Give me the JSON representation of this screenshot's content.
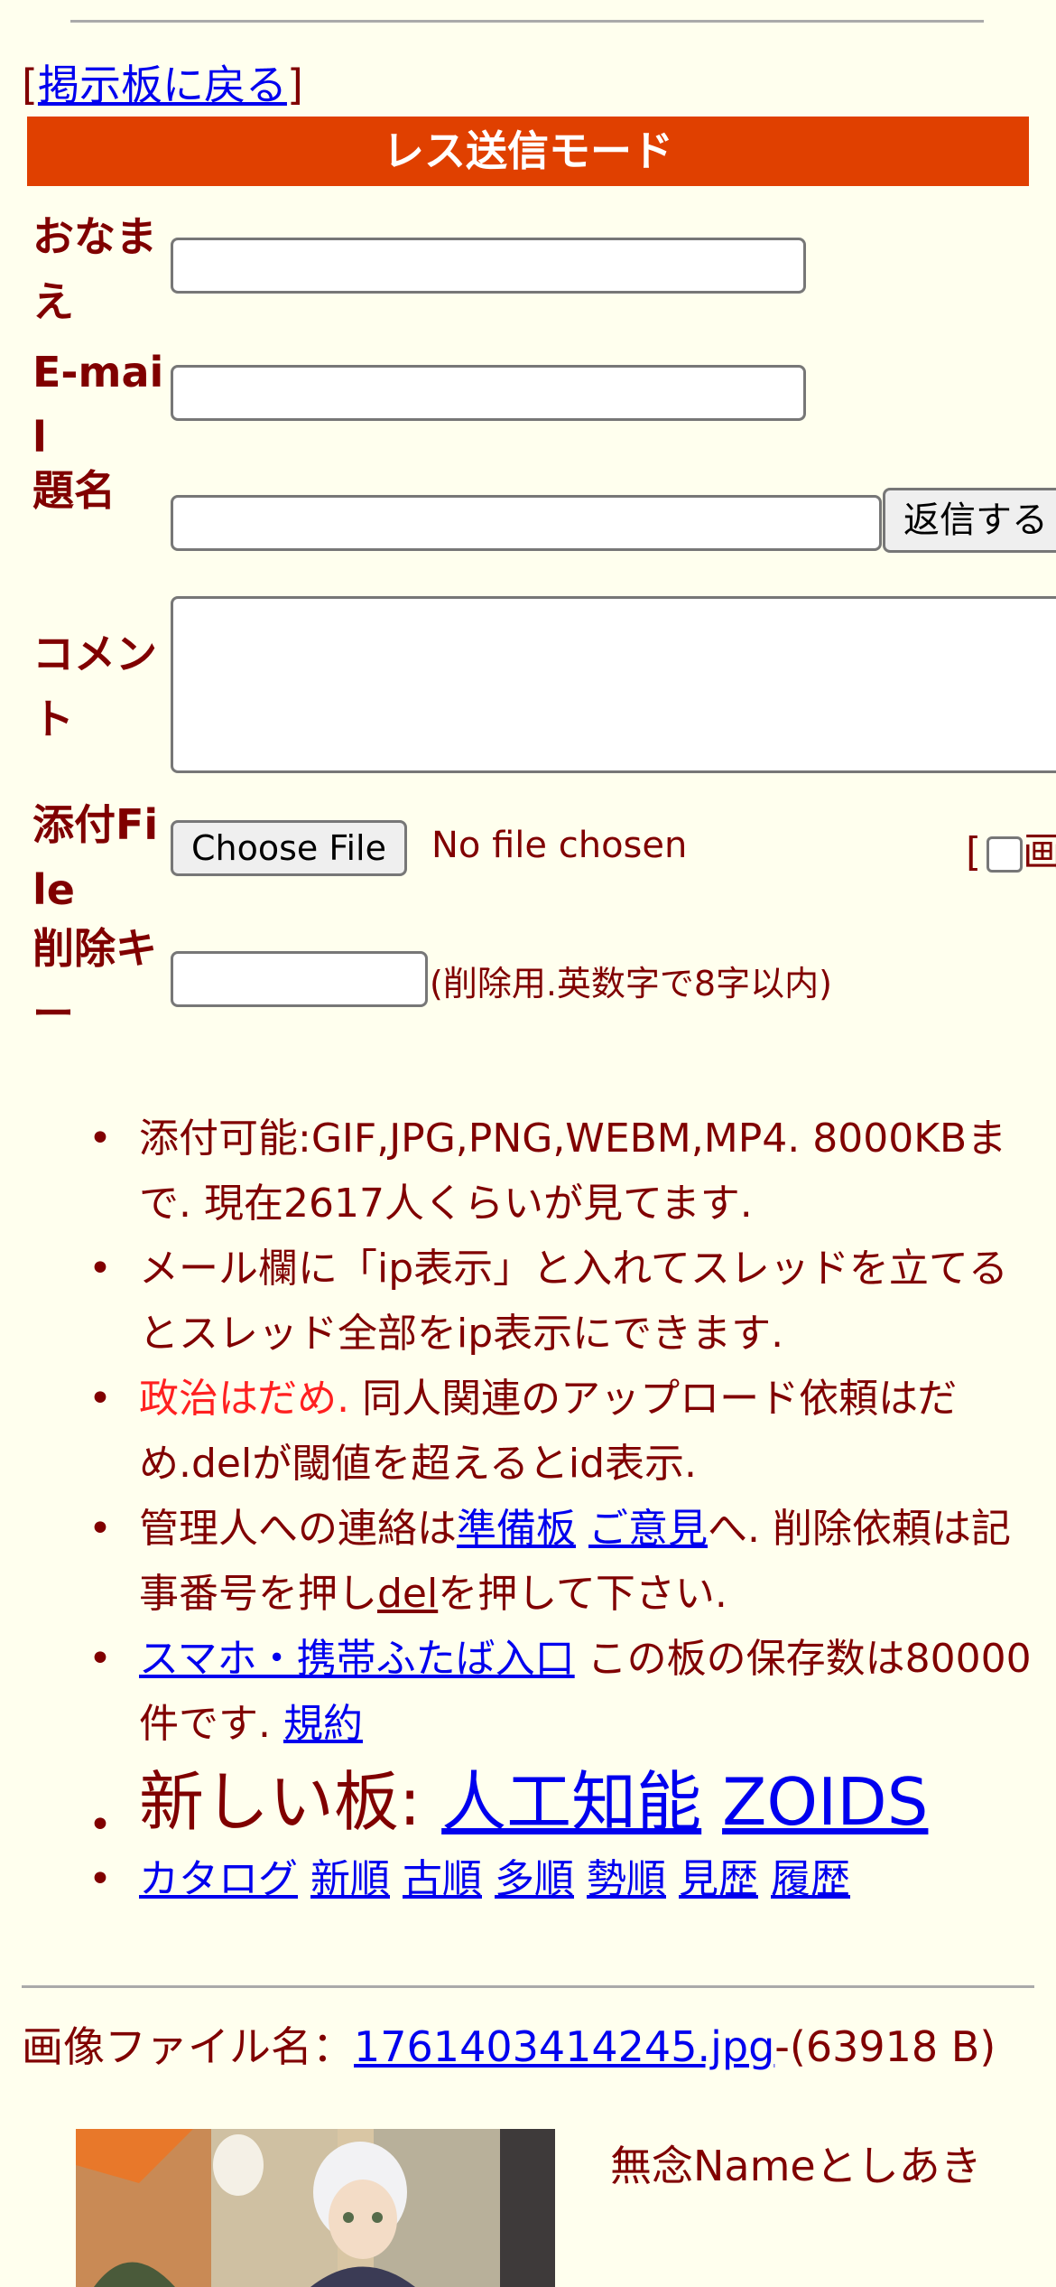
{
  "nav": {
    "back_prefix": "[",
    "back_link": "掲示板に戻る",
    "back_suffix": "]"
  },
  "form": {
    "mode_title": "レス送信モード",
    "name_label": "おなまえ",
    "email_label": "E-mail",
    "subject_label": "題名",
    "submit_label": "返信する",
    "comment_label": "コメント",
    "file_label": "添付File",
    "choose_file_label": "Choose File",
    "no_file_text": "No file chosen",
    "image_toggle_prefix": "[",
    "image_toggle_text": "画",
    "delkey_label": "削除キー",
    "delkey_hint": "(削除用.英数字で8字以内)"
  },
  "notes": {
    "n1": "添付可能:GIF,JPG,PNG,WEBM,MP4. 8000KBまで. 現在2617人くらいが見てます.",
    "n2": "メール欄に「ip表示」と入れてスレッドを立てるとスレッド全部をip表示にできます.",
    "n3_red": "政治はだめ.",
    "n3_rest": " 同人関連のアップロード依頼はだめ.delが閾値を超えるとid表示.",
    "n4_pre": "管理人への連絡は",
    "n4_link1": "準備板",
    "n4_link2": "ご意見",
    "n4_mid": "へ. 削除依頼は記事番号を押し",
    "n4_del": "del",
    "n4_post": "を押して下さい.",
    "n5_link": "スマホ・携帯ふたば入口",
    "n5_text": " この板の保存数は80000件です. ",
    "n5_rules": "規約",
    "n6_prefix": "新しい板: ",
    "n6_link1": "人工知能",
    "n6_link2": "ZOIDS",
    "sort_links": [
      "カタログ",
      "新順",
      "古順",
      "多順",
      "勢順",
      "見歴",
      "履歴"
    ]
  },
  "post": {
    "file_label": "画像ファイル名：",
    "file_name": "1761403414245.jpg",
    "file_size": "-(63918 B)",
    "poster": "無念Nameとしあき"
  },
  "colors": {
    "background": "#ffffee",
    "text": "#800000",
    "mode_bar": "#e04000",
    "link": "#0000ee",
    "warning": "#ff2020"
  }
}
